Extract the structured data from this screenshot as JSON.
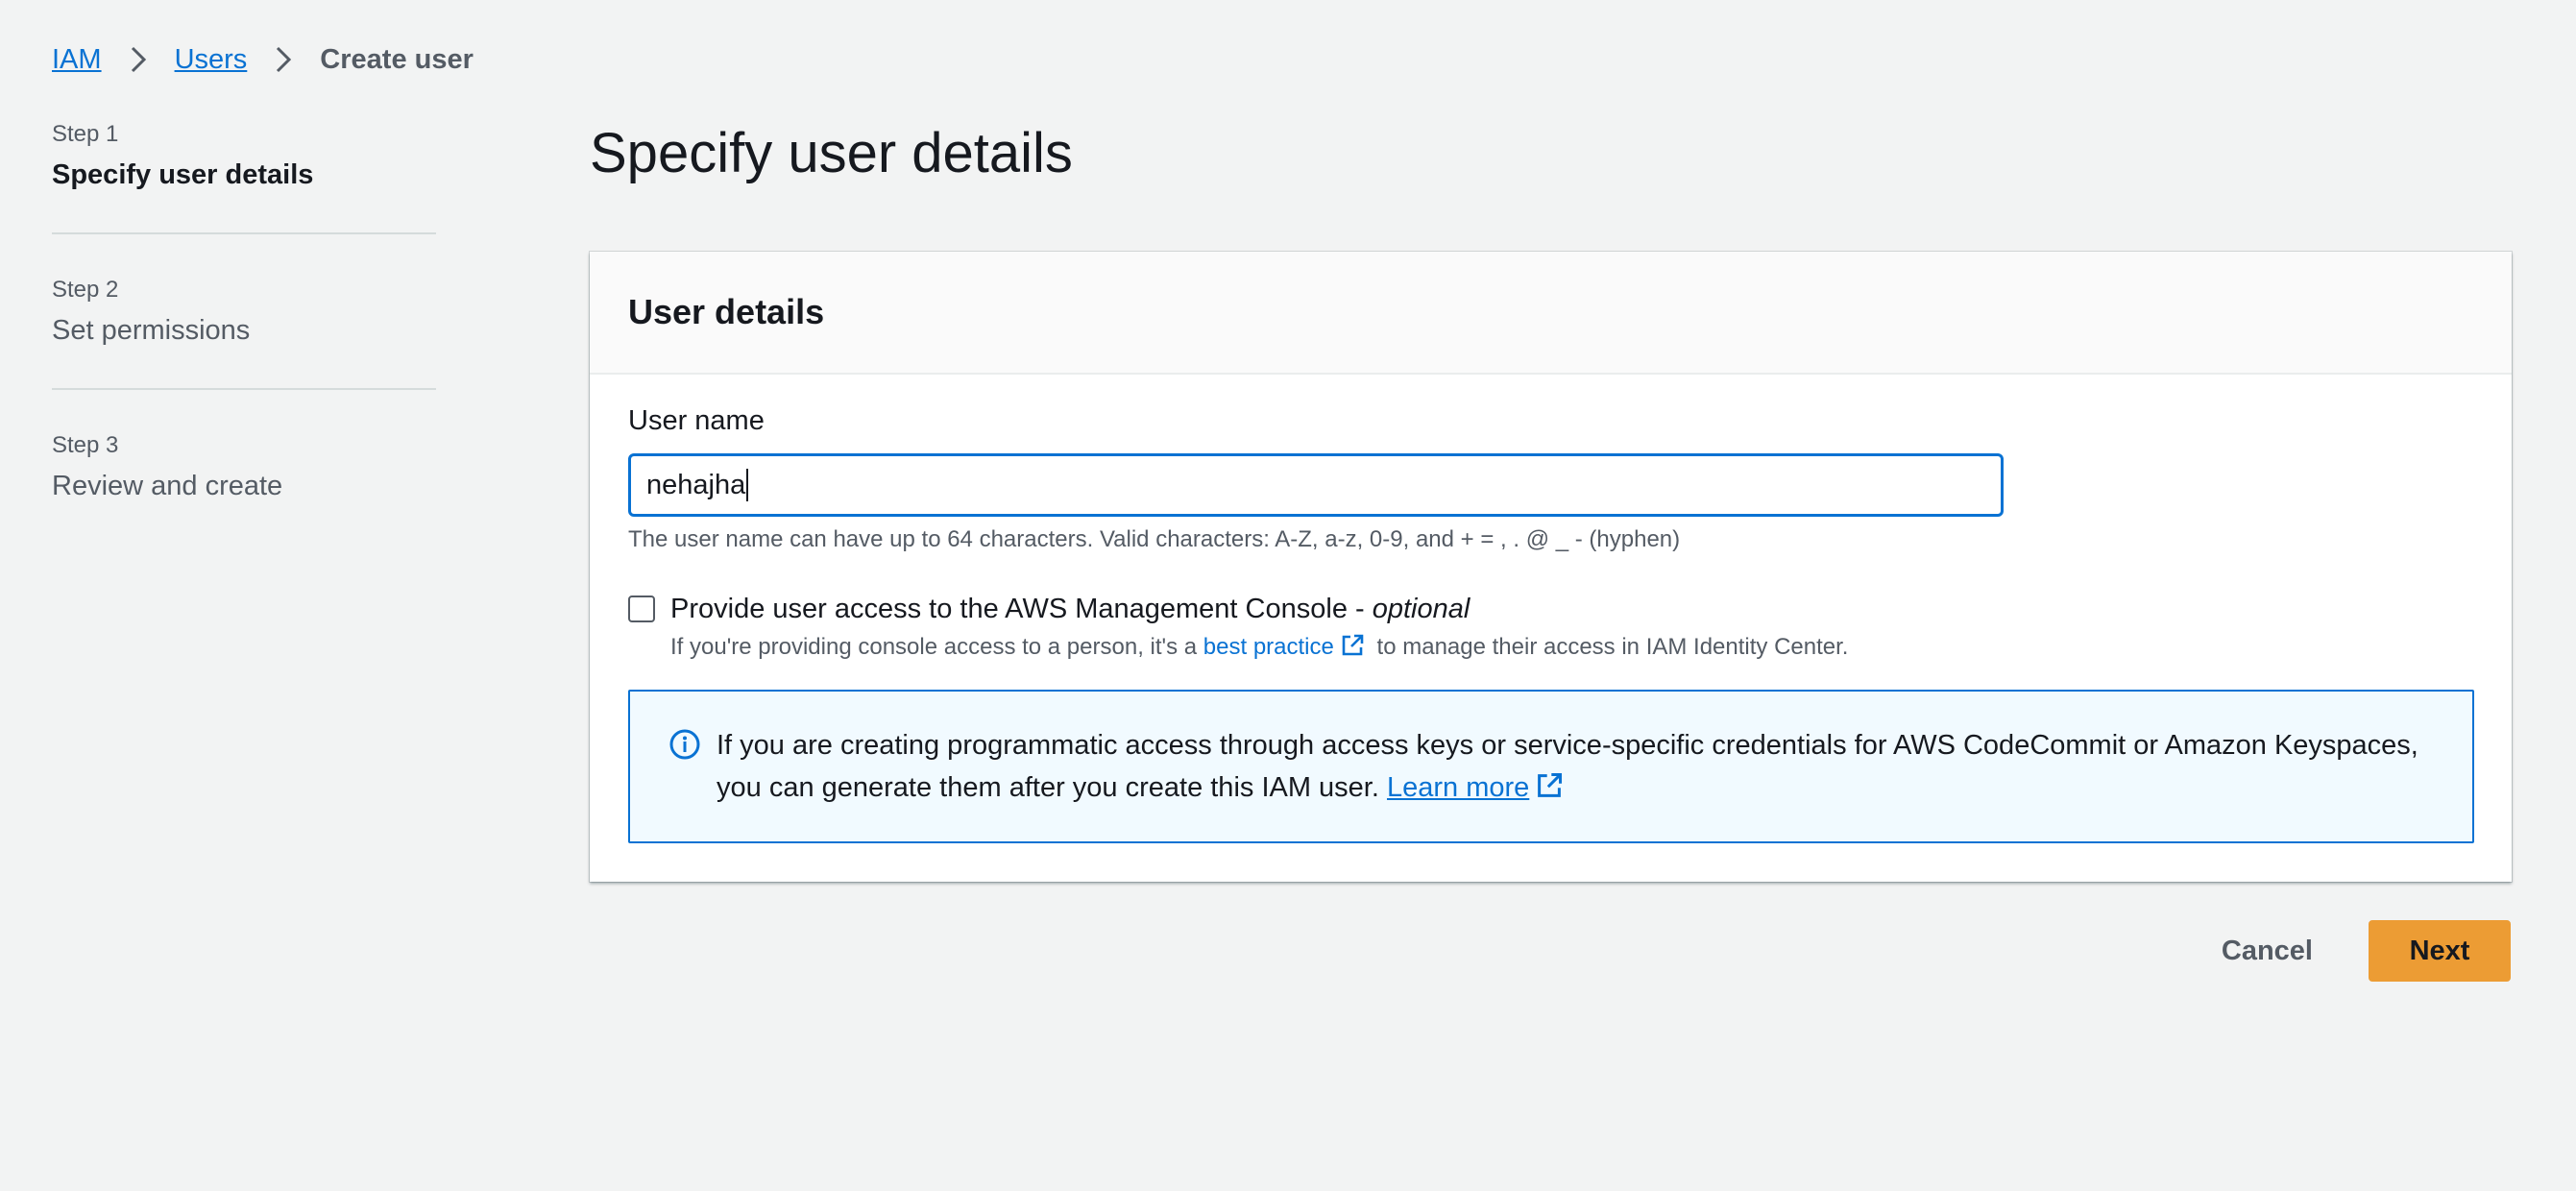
{
  "breadcrumb": {
    "items": [
      {
        "label": "IAM"
      },
      {
        "label": "Users"
      },
      {
        "label": "Create user"
      }
    ]
  },
  "steps": [
    {
      "number": "Step 1",
      "title": "Specify user details",
      "active": true
    },
    {
      "number": "Step 2",
      "title": "Set permissions",
      "active": false
    },
    {
      "number": "Step 3",
      "title": "Review and create",
      "active": false
    }
  ],
  "page": {
    "title": "Specify user details"
  },
  "user_details": {
    "header": "User details",
    "username_label": "User name",
    "username_value": "nehajha",
    "username_constraint": "The user name can have up to 64 characters. Valid characters: A-Z, a-z, 0-9, and + = , . @ _ - (hyphen)",
    "console_access": {
      "label": "Provide user access to the AWS Management Console - ",
      "optional": "optional",
      "checked": false,
      "desc_before": "If you're providing console access to a person, it's a ",
      "desc_link": "best practice",
      "desc_after": " to manage their access in IAM Identity Center."
    },
    "info_alert": {
      "text": "If you are creating programmatic access through access keys or service-specific credentials for AWS CodeCommit or Amazon Keyspaces, you can generate them after you create this IAM user. ",
      "link": "Learn more"
    }
  },
  "actions": {
    "cancel_label": "Cancel",
    "next_label": "Next"
  },
  "colors": {
    "link": "#0972d3",
    "primary_button": "#ec9c34",
    "background": "#f2f3f3"
  }
}
